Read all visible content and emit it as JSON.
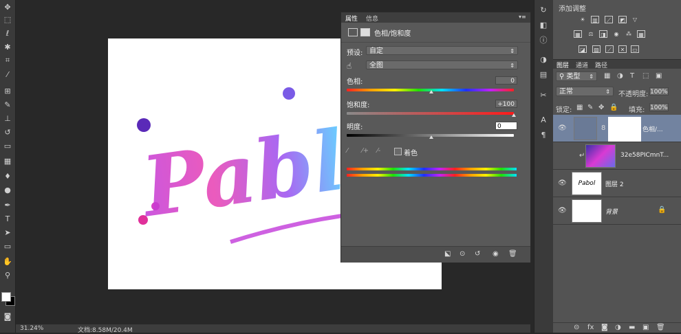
{
  "status": {
    "zoom": "31.24%",
    "doc_size": "文档:8.58M/20.4M"
  },
  "properties": {
    "tabs": [
      "属性",
      "信息"
    ],
    "title": "色相/饱和度",
    "preset_label": "预设:",
    "preset_value": "自定",
    "channel_value": "全图",
    "hue_label": "色相:",
    "hue_value": "0",
    "saturation_label": "饱和度:",
    "saturation_value": "+100",
    "lightness_label": "明度:",
    "lightness_value": "0",
    "colorize_label": "着色"
  },
  "adjustments": {
    "title": "添加调整"
  },
  "layers": {
    "tabs": [
      "图层",
      "通道",
      "路径"
    ],
    "filter": "类型",
    "blend_mode": "正常",
    "opacity_label": "不透明度:",
    "opacity_value": "100%",
    "lock_label": "锁定:",
    "fill_label": "填充:",
    "fill_value": "100%",
    "items": [
      {
        "name": "色相/..."
      },
      {
        "name": "32e58PICmnT..."
      },
      {
        "name": "图层 2"
      },
      {
        "name": "背景"
      }
    ]
  },
  "canvas": {
    "text": "Pabl"
  }
}
